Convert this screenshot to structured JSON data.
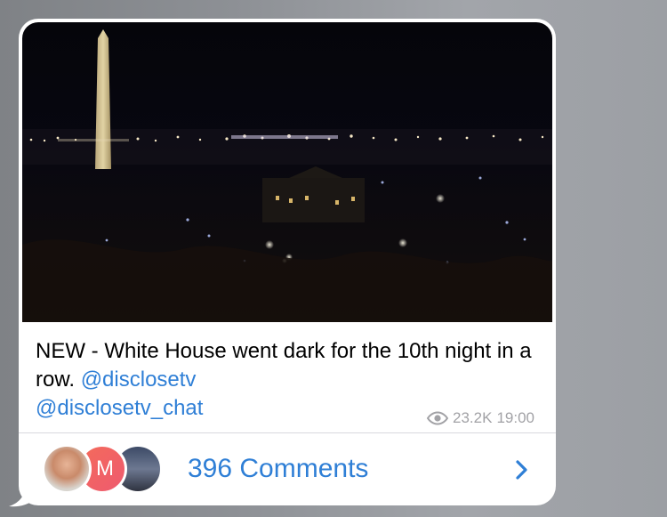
{
  "post": {
    "caption_text": "NEW - White House went dark for the 10th night in a row.",
    "mention_1": "@disclosetv",
    "mention_2": "@disclosetv_chat",
    "views": "23.2K",
    "time": "19:00"
  },
  "comments": {
    "label": "396 Comments",
    "avatars": [
      {
        "kind": "photo"
      },
      {
        "kind": "initial",
        "letter": "M",
        "color": "#f06060"
      },
      {
        "kind": "photo"
      }
    ]
  },
  "icons": {
    "views": "eye-icon",
    "open": "chevron-right-icon"
  },
  "colors": {
    "link": "#2f7fd6",
    "meta": "#a2a2a6",
    "bubble": "#ffffff"
  }
}
